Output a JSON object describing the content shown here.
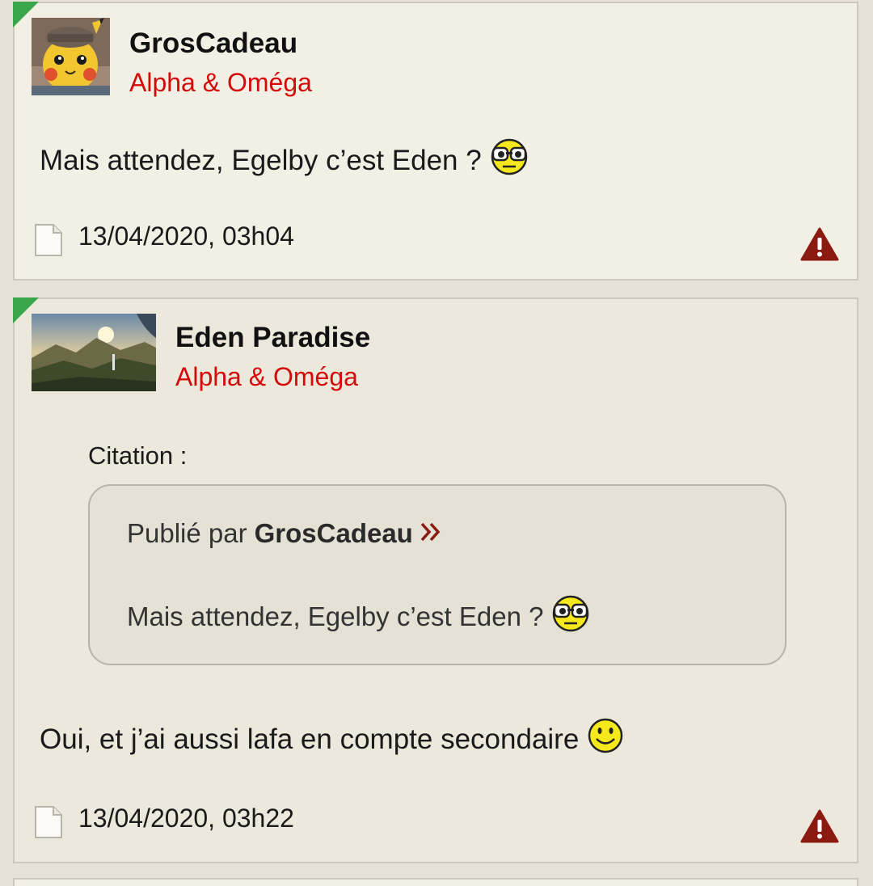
{
  "posts": [
    {
      "author": "GrosCadeau",
      "group": "Alpha & Oméga",
      "avatar": "pikachu-detective-avatar",
      "content": "Mais attendez, Egelby c’est Eden ?",
      "content_smiley": "glasses-smiley-icon",
      "date": "13/04/2020, 03h04",
      "footer_icon": "document-icon",
      "report_icon": "warning-icon"
    },
    {
      "author": "Eden Paradise",
      "group": "Alpha & Oméga",
      "avatar": "landscape-avatar",
      "quote": {
        "label": "Citation :",
        "published_by": "Publié par",
        "author": "GrosCadeau",
        "link_icon": "double-chevron-right-icon",
        "text": "Mais attendez, Egelby c’est Eden ?",
        "smiley": "glasses-smiley-icon"
      },
      "content": "Oui, et j’ai aussi lafa en compte secondaire",
      "content_smiley": "smile-icon",
      "date": "13/04/2020, 03h22",
      "footer_icon": "document-icon",
      "report_icon": "warning-icon"
    }
  ],
  "colors": {
    "page_background": "#e7e2d5",
    "post_background": "#f2efe5",
    "group_red": "#d40a0a",
    "new_marker_green": "#3aa64a",
    "warning_red": "#8b1a10",
    "chevron_red": "#8b1a10"
  }
}
